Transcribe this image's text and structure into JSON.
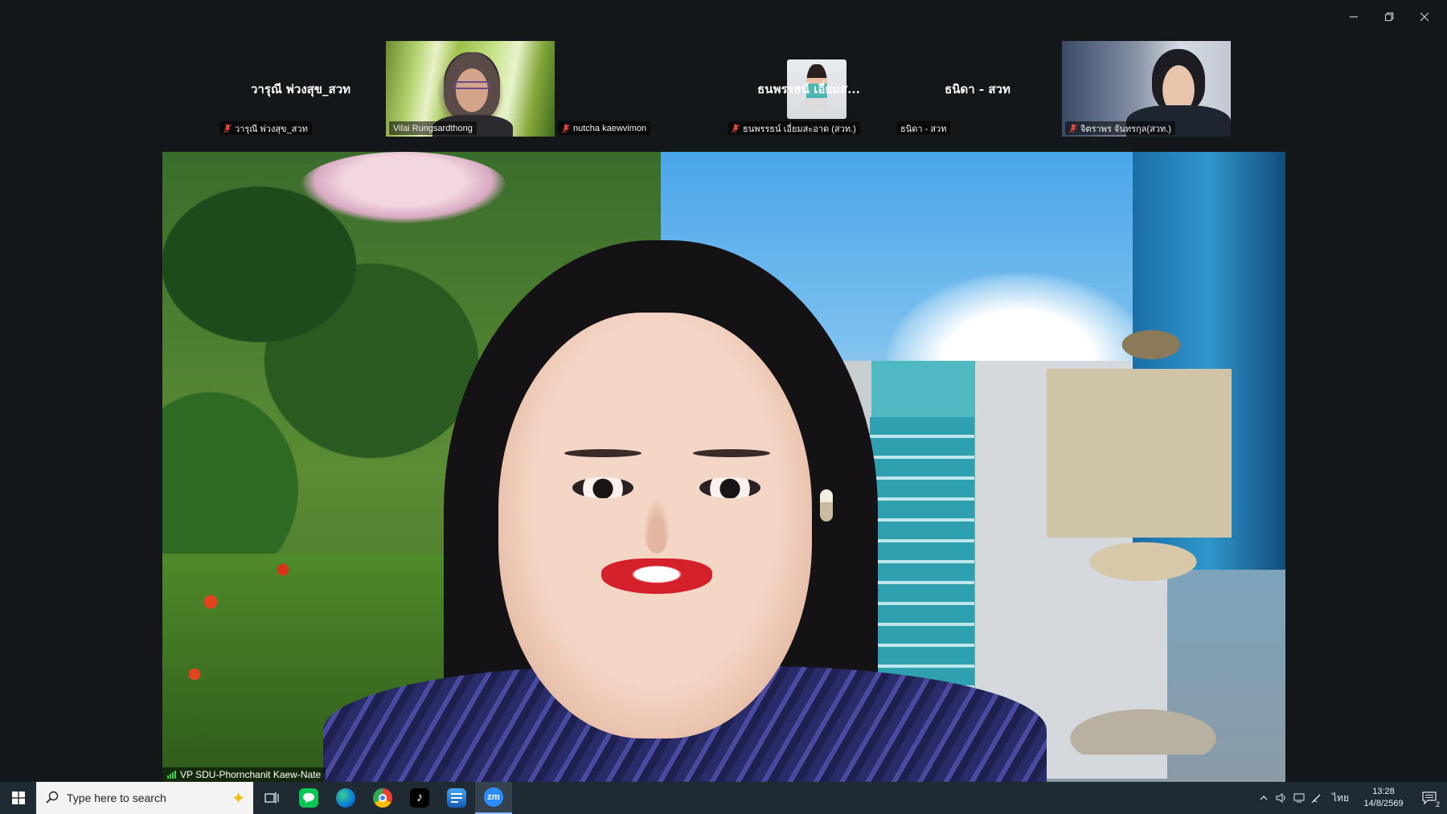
{
  "window": {
    "controls": {
      "minimize_icon": "minimize-icon",
      "restore_icon": "restore-icon",
      "close_icon": "close-icon"
    }
  },
  "participants": [
    {
      "display_name": "วารุณี พ่วงสุข_สวท",
      "label": "วารุณี พ่วงสุข_สวท",
      "muted": true,
      "video": false
    },
    {
      "display_name": "",
      "label": "Vilai Rungsardthong",
      "muted": false,
      "video": true
    },
    {
      "display_name": "",
      "label": "nutcha kaewvimon",
      "muted": true,
      "video": true
    },
    {
      "display_name": "ธนพรรธน์ เอี่ยมส...",
      "label": "ธนพรรธน์ เอี่ยมสะอาด (สวท.)",
      "muted": true,
      "video": false
    },
    {
      "display_name": "ธนิดา - สวท",
      "label": "ธนิดา - สวท",
      "muted": false,
      "video": false
    },
    {
      "display_name": "",
      "label": "จิตราพร จันทรกุล(สวท.)",
      "muted": true,
      "video": true
    }
  ],
  "active_speaker": {
    "label": "VP SDU-Phornchanit Kaew-Nate"
  },
  "taskbar": {
    "search_placeholder": "Type here to search",
    "apps": [
      "task-view",
      "line",
      "edge",
      "chrome",
      "tiktok",
      "word",
      "zoom"
    ],
    "active_app": "zoom",
    "zoom_label": "zm",
    "language": "ไทย",
    "time": "13:28",
    "date": "14/8/2569",
    "notification_count": "2"
  },
  "colors": {
    "background": "#131719",
    "taskbar": "#1f2a33",
    "muted_mic": "#e0453a",
    "signal": "#3fd04f"
  }
}
